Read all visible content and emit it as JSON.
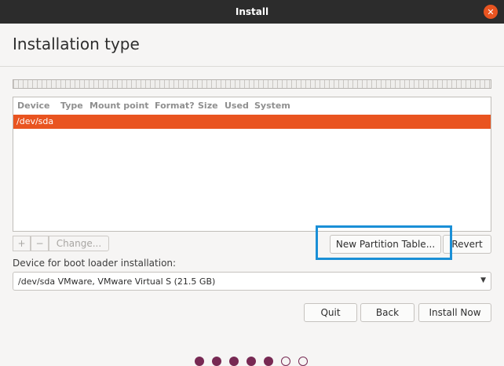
{
  "window": {
    "title": "Install"
  },
  "page": {
    "title": "Installation type"
  },
  "table": {
    "columns": [
      "Device",
      "Type",
      "Mount point",
      "Format?",
      "Size",
      "Used",
      "System"
    ],
    "rows": [
      {
        "device": "/dev/sda"
      }
    ]
  },
  "toolbar": {
    "add_label": "+",
    "remove_label": "−",
    "change_label": "Change...",
    "new_partition_table_label": "New Partition Table...",
    "revert_label": "Revert"
  },
  "boot_loader": {
    "label": "Device for boot loader installation:",
    "selected": "/dev/sda VMware, VMware Virtual S (21.5 GB)"
  },
  "actions": {
    "quit_label": "Quit",
    "back_label": "Back",
    "install_label": "Install Now"
  },
  "progress": {
    "total_steps": 7,
    "completed_steps": 5
  },
  "colors": {
    "accent": "#e95420",
    "highlight_box": "#1a8fd6",
    "dot": "#772953"
  }
}
